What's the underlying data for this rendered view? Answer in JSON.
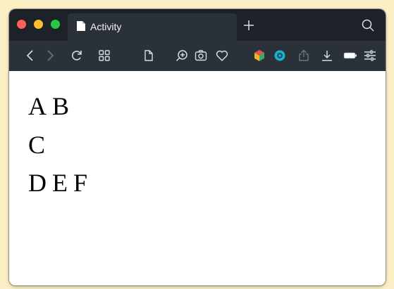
{
  "tab": {
    "title": "Activity"
  },
  "toolbar": {
    "icons": [
      "back-icon",
      "forward-icon",
      "reload-icon",
      "tab-grid-icon",
      "page-icon",
      "zoom-in-icon",
      "camera-icon",
      "heart-icon",
      "cube-extension-icon",
      "circle-extension-icon",
      "share-icon",
      "download-icon",
      "battery-icon",
      "settings-sliders-icon"
    ]
  },
  "content": {
    "lines": [
      [
        "A",
        "B"
      ],
      [
        "C"
      ],
      [
        "D",
        "E",
        "F"
      ]
    ]
  },
  "colors": {
    "desktop": "#fbf0c6",
    "tabbar": "#1d2228",
    "toolbar": "#2b3139",
    "close": "#ff5f57",
    "minimize": "#febc2e",
    "maximize": "#28c840"
  }
}
